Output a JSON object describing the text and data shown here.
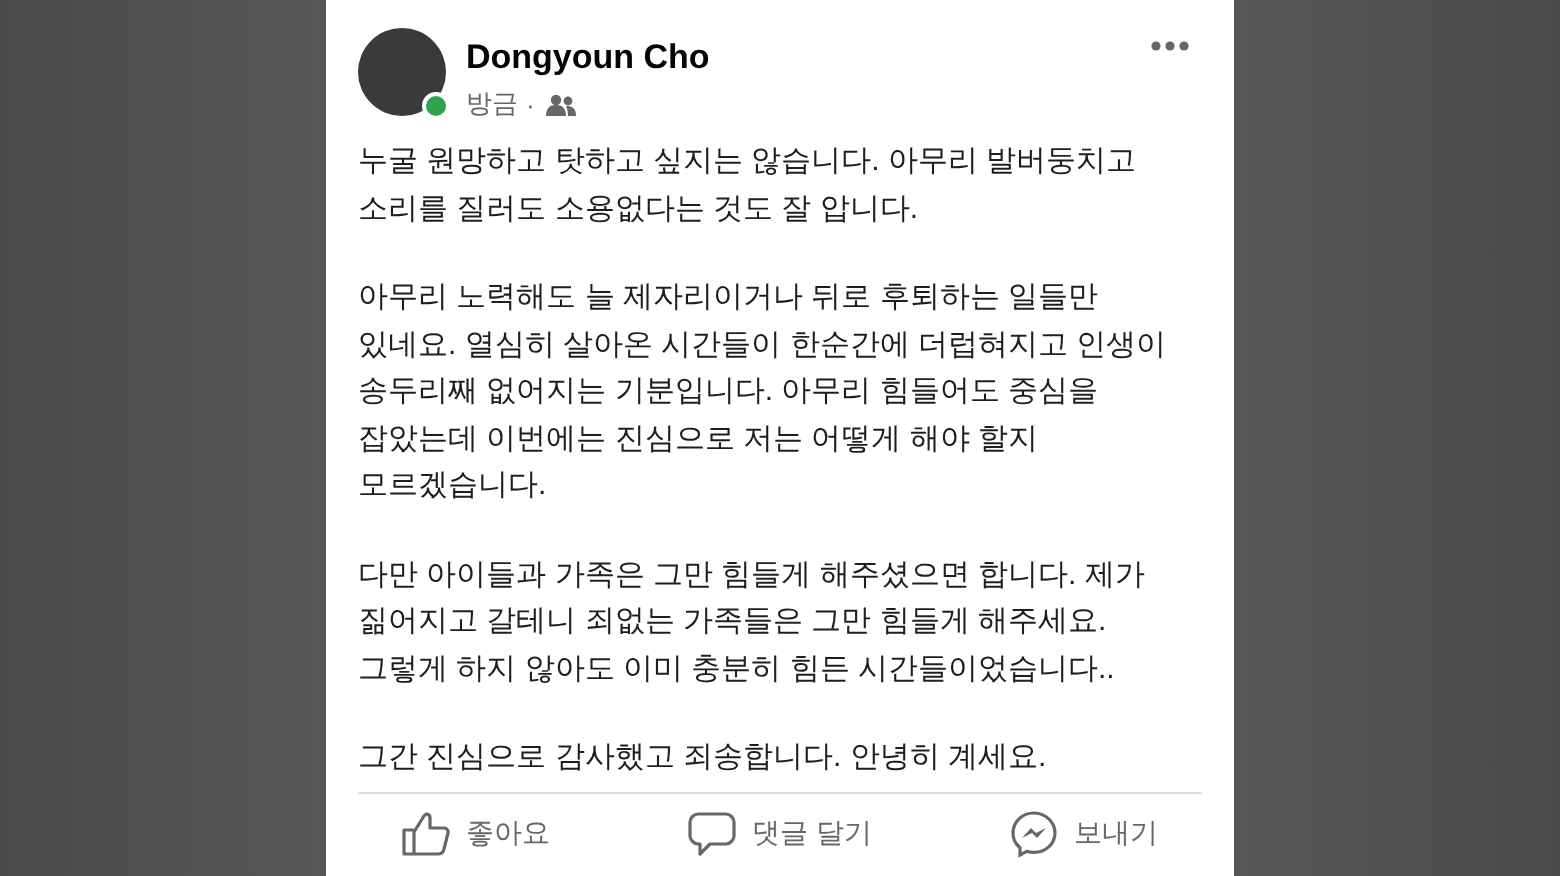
{
  "post": {
    "author": "Dongyoun Cho",
    "online": true,
    "time": "방금",
    "separator": "·",
    "paragraphs": [
      [
        "누굴 원망하고 탓하고 싶지는 않습니다. 아무리 발버둥치고",
        "소리를 질러도 소용없다는 것도 잘 압니다."
      ],
      [
        "아무리 노력해도 늘 제자리이거나 뒤로 후퇴하는 일들만",
        "있네요. 열심히 살아온 시간들이 한순간에 더럽혀지고 인생이",
        "송두리째 없어지는 기분입니다. 아무리 힘들어도 중심을",
        "잡았는데 이번에는 진심으로 저는 어떻게 해야 할지",
        "모르겠습니다."
      ],
      [
        "다만 아이들과 가족은 그만 힘들게 해주셨으면 합니다. 제가",
        "짊어지고 갈테니 죄없는 가족들은 그만 힘들게 해주세요.",
        "그렇게 하지 않아도 이미 충분히 힘든 시간들이었습니다.."
      ],
      [
        "그간 진심으로 감사했고 죄송합니다. 안녕히 계세요."
      ]
    ],
    "actions": [
      {
        "kind": "like",
        "label": "좋아요"
      },
      {
        "kind": "comment",
        "label": "댓글 달기"
      },
      {
        "kind": "send",
        "label": "보내기"
      }
    ]
  }
}
